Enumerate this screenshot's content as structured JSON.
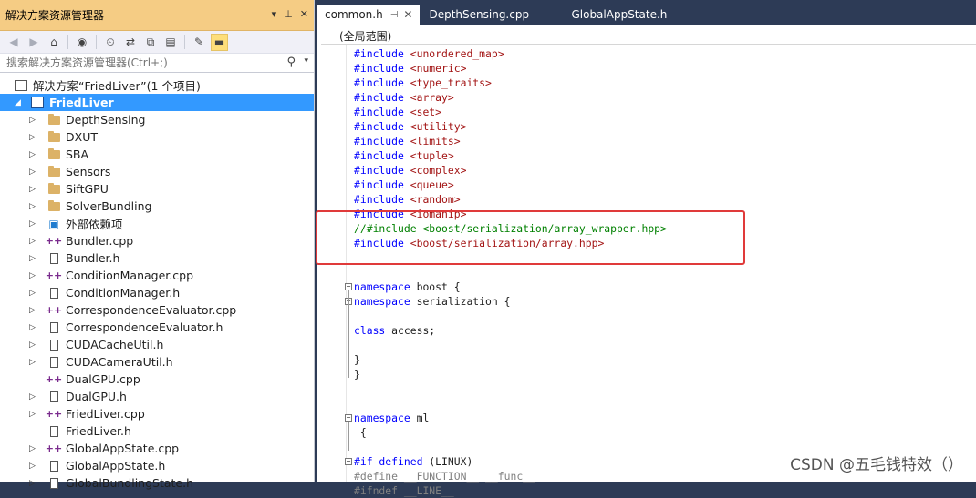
{
  "solution_explorer": {
    "title": "解决方案资源管理器",
    "title_buttons": [
      "▾",
      "⊥",
      "✕"
    ],
    "search_placeholder": "搜索解决方案资源管理器(Ctrl+;)",
    "solution_label": "解决方案“FriedLiver”(1 个项目)",
    "project_label": "FriedLiver",
    "items": [
      {
        "label": "DepthSensing",
        "type": "folder",
        "expandable": true
      },
      {
        "label": "DXUT",
        "type": "folder",
        "expandable": true
      },
      {
        "label": "SBA",
        "type": "folder",
        "expandable": true
      },
      {
        "label": "Sensors",
        "type": "folder",
        "expandable": true
      },
      {
        "label": "SiftGPU",
        "type": "folder",
        "expandable": true
      },
      {
        "label": "SolverBundling",
        "type": "folder",
        "expandable": true
      },
      {
        "label": "外部依赖项",
        "type": "ref",
        "expandable": true
      },
      {
        "label": "Bundler.cpp",
        "type": "cpp",
        "expandable": true
      },
      {
        "label": "Bundler.h",
        "type": "h",
        "expandable": true
      },
      {
        "label": "ConditionManager.cpp",
        "type": "cpp",
        "expandable": true
      },
      {
        "label": "ConditionManager.h",
        "type": "h",
        "expandable": true
      },
      {
        "label": "CorrespondenceEvaluator.cpp",
        "type": "cpp",
        "expandable": true
      },
      {
        "label": "CorrespondenceEvaluator.h",
        "type": "h",
        "expandable": true
      },
      {
        "label": "CUDACacheUtil.h",
        "type": "h",
        "expandable": true
      },
      {
        "label": "CUDACameraUtil.h",
        "type": "h",
        "expandable": true
      },
      {
        "label": "DualGPU.cpp",
        "type": "cpp",
        "expandable": false
      },
      {
        "label": "DualGPU.h",
        "type": "h",
        "expandable": true
      },
      {
        "label": "FriedLiver.cpp",
        "type": "cpp",
        "expandable": true
      },
      {
        "label": "FriedLiver.h",
        "type": "h",
        "expandable": false
      },
      {
        "label": "GlobalAppState.cpp",
        "type": "cpp",
        "expandable": true
      },
      {
        "label": "GlobalAppState.h",
        "type": "h",
        "expandable": true
      },
      {
        "label": "GlobalBundlingState.h",
        "type": "h",
        "expandable": true
      }
    ]
  },
  "tabs": [
    {
      "label": "common.h",
      "active": true
    },
    {
      "label": "DepthSensing.cpp",
      "active": false
    },
    {
      "label": "GlobalAppState.h",
      "active": false
    }
  ],
  "editor": {
    "scope": "(全局范围)",
    "lines": [
      {
        "kw": "#include",
        "rest": " <unordered_map>",
        "style": "include"
      },
      {
        "kw": "#include",
        "rest": " <numeric>",
        "style": "include"
      },
      {
        "kw": "#include",
        "rest": " <type_traits>",
        "style": "include"
      },
      {
        "kw": "#include",
        "rest": " <array>",
        "style": "include"
      },
      {
        "kw": "#include",
        "rest": " <set>",
        "style": "include"
      },
      {
        "kw": "#include",
        "rest": " <utility>",
        "style": "include"
      },
      {
        "kw": "#include",
        "rest": " <limits>",
        "style": "include"
      },
      {
        "kw": "#include",
        "rest": " <tuple>",
        "style": "include"
      },
      {
        "kw": "#include",
        "rest": " <complex>",
        "style": "include"
      },
      {
        "kw": "#include",
        "rest": " <queue>",
        "style": "include"
      },
      {
        "kw": "#include",
        "rest": " <random>",
        "style": "include"
      },
      {
        "kw": "#include",
        "rest": " <iomanip>",
        "style": "include"
      },
      {
        "kw": "//#include <boost/serialization/array_wrapper.hpp>",
        "rest": "",
        "style": "comment"
      },
      {
        "kw": "#include",
        "rest": " <boost/serialization/array.hpp>",
        "style": "include"
      },
      {
        "kw": "",
        "rest": "",
        "style": "blank"
      },
      {
        "kw": "",
        "rest": "",
        "style": "blank"
      },
      {
        "kw": "namespace",
        "rest": " boost {",
        "style": "keyword"
      },
      {
        "kw": "namespace",
        "rest": " serialization {",
        "style": "keyword"
      },
      {
        "kw": "",
        "rest": "",
        "style": "blank"
      },
      {
        "kw": "class",
        "rest": " access;",
        "style": "keyword"
      },
      {
        "kw": "",
        "rest": "",
        "style": "blank"
      },
      {
        "kw": "",
        "rest": "}",
        "style": "plain"
      },
      {
        "kw": "",
        "rest": "}",
        "style": "plain"
      },
      {
        "kw": "",
        "rest": "",
        "style": "blank"
      },
      {
        "kw": "",
        "rest": "",
        "style": "blank"
      },
      {
        "kw": "namespace",
        "rest": " ml",
        "style": "keyword"
      },
      {
        "kw": "",
        "rest": " {",
        "style": "plain"
      },
      {
        "kw": "",
        "rest": "",
        "style": "blank"
      },
      {
        "kw": "#if defined",
        "rest": " (LINUX)",
        "style": "keyword"
      },
      {
        "kw": "#define",
        "rest": " __FUNCTION__ __func__",
        "style": "gray"
      },
      {
        "kw": "#ifndef",
        "rest": " __LINE__",
        "style": "gray"
      }
    ]
  },
  "watermark": "CSDN @五毛钱特效（）"
}
